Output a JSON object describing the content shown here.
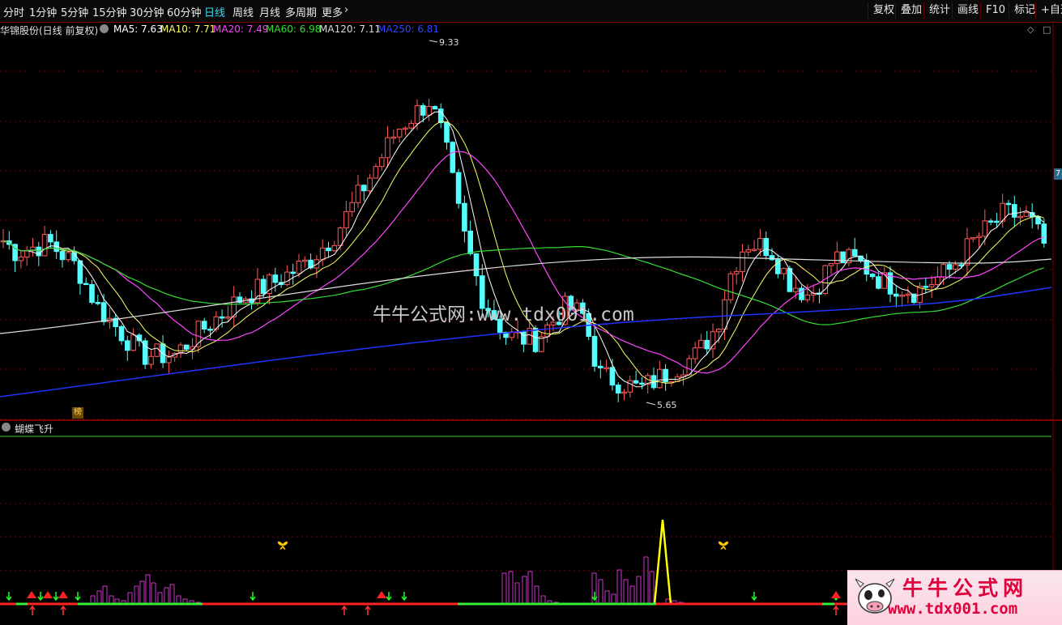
{
  "toolbar": {
    "timeframes": [
      "分时",
      "1分钟",
      "5分钟",
      "15分钟",
      "30分钟",
      "60分钟",
      "日线",
      "周线",
      "月线",
      "多周期",
      "更多"
    ],
    "active_timeframe": "日线",
    "more_arrow": "›",
    "buttons": [
      "复权",
      "叠加",
      "统计",
      "画线",
      "F10",
      "标记",
      "+自选"
    ]
  },
  "legend": {
    "stock": "华锦股份(日线 前复权)",
    "ma5": "MA5: 7.63",
    "ma10": "MA10: 7.71",
    "ma20": "MA20: 7.49",
    "ma60": "MA60: 6.98",
    "ma120": "MA120: 7.11",
    "ma250": "MA250: 6.81"
  },
  "colors": {
    "up": "#ff5a5a",
    "down": "#54ffff",
    "ma5": "#ffffff",
    "ma10": "#ffff66",
    "ma20": "#ff44ff",
    "ma60": "#33dd33",
    "ma120": "#dddddd",
    "ma250": "#2233ff",
    "grid": "#7a0000"
  },
  "price_chart": {
    "high_label": "9.33",
    "low_label": "5.65",
    "price_tag": "7",
    "badge": "榜",
    "watermark": "牛牛公式网:www.tdx001.com"
  },
  "indicator": {
    "name": "蝴蝶飞升",
    "icon": "butterfly-icon"
  },
  "logo": {
    "title": "牛牛公式网",
    "url": "www.tdx001.com",
    "icon": "cow-icon"
  }
}
